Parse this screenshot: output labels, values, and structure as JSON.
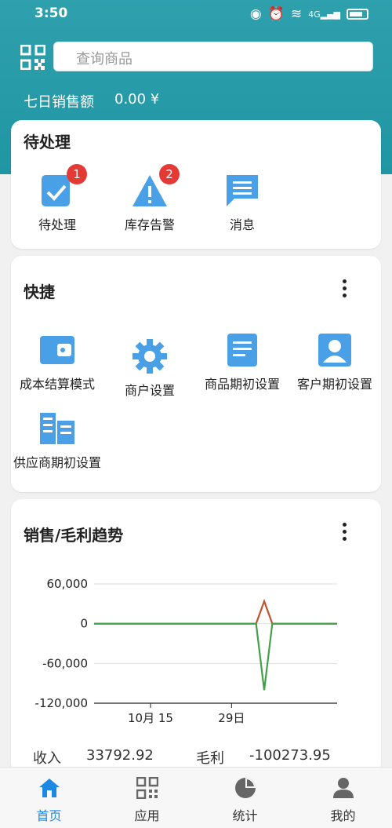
{
  "status_bar": {
    "time": "3:50",
    "network": "4G"
  },
  "search": {
    "placeholder": "查询商品"
  },
  "sales_summary": {
    "label": "七日销售额",
    "value": "0.00 ¥"
  },
  "pending_card": {
    "title": "待处理",
    "items": [
      {
        "label": "待处理",
        "icon": "task-check-icon",
        "badge": "1"
      },
      {
        "label": "库存告警",
        "icon": "warning-icon",
        "badge": "2"
      },
      {
        "label": "消息",
        "icon": "message-icon"
      }
    ]
  },
  "shortcut_card": {
    "title": "快捷",
    "items": [
      {
        "label": "成本结算模式",
        "icon": "wallet-icon"
      },
      {
        "label": "商户设置",
        "icon": "gear-icon"
      },
      {
        "label": "商品期初设置",
        "icon": "document-icon"
      },
      {
        "label": "客户期初设置",
        "icon": "contact-card-icon"
      },
      {
        "label": "供应商期初设置",
        "icon": "building-icon"
      }
    ]
  },
  "trend_card": {
    "title": "销售/毛利趋势",
    "summary": {
      "income_label": "收入",
      "income_value": "33792.92",
      "profit_label": "毛利",
      "profit_value": "-100273.95"
    }
  },
  "chart_data": {
    "type": "line",
    "x_tick_labels": [
      "10月 15",
      "29日"
    ],
    "y_ticks": [
      "60,000",
      "0",
      "-60,000",
      "-120,000"
    ],
    "ylim": [
      -120000,
      60000
    ],
    "grid": true,
    "x": [
      0,
      1,
      2,
      3,
      4,
      5,
      6,
      7,
      8,
      9,
      10,
      11,
      12,
      13,
      14,
      15,
      16,
      17,
      18,
      19,
      20,
      21,
      22,
      23,
      24,
      25,
      26,
      27,
      28,
      29,
      30
    ],
    "series": [
      {
        "color": "#c0522c",
        "values": [
          0,
          0,
          0,
          0,
          0,
          0,
          0,
          0,
          0,
          0,
          0,
          0,
          0,
          0,
          0,
          0,
          0,
          0,
          0,
          0,
          0,
          33793,
          0,
          0,
          0,
          0,
          0,
          0,
          0,
          0,
          0
        ]
      },
      {
        "color": "#43a047",
        "values": [
          0,
          0,
          0,
          0,
          0,
          0,
          0,
          0,
          0,
          0,
          0,
          0,
          0,
          0,
          0,
          0,
          0,
          0,
          0,
          0,
          0,
          -100274,
          0,
          0,
          0,
          0,
          0,
          0,
          0,
          0,
          0
        ]
      }
    ]
  },
  "bottom_nav": [
    {
      "label": "首页",
      "icon": "home-icon",
      "active": true
    },
    {
      "label": "应用",
      "icon": "qr-grid-icon"
    },
    {
      "label": "统计",
      "icon": "pie-chart-icon"
    },
    {
      "label": "我的",
      "icon": "person-icon"
    }
  ],
  "colors": {
    "header": "#2096a3",
    "accent": "#1e88e5",
    "icon_blue": "#4aa0e6",
    "badge": "#e53935"
  }
}
